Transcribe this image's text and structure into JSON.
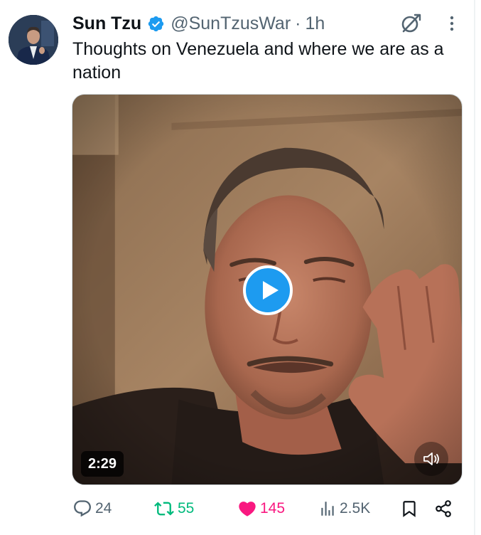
{
  "tweet": {
    "display_name": "Sun Tzu",
    "verified": true,
    "handle": "@SunTzusWar",
    "separator": "·",
    "time_ago": "1h",
    "text": "Thoughts on Venezuela and where we are as a nation",
    "media": {
      "type": "video",
      "duration": "2:29",
      "muted": true
    },
    "actions": {
      "replies": "24",
      "retweets": "55",
      "likes": "145",
      "views": "2.5K",
      "liked": true,
      "retweeted": true
    }
  },
  "colors": {
    "accent_blue": "#1d9bf0",
    "retweet_green": "#00ba7c",
    "like_pink": "#f91880",
    "secondary_text": "#536471",
    "primary_text": "#0f1419"
  },
  "icons": [
    "verified-badge-icon",
    "grok-icon",
    "more-icon",
    "play-icon",
    "volume-muted-icon",
    "reply-icon",
    "retweet-icon",
    "heart-icon",
    "views-icon",
    "bookmark-icon",
    "share-icon"
  ]
}
